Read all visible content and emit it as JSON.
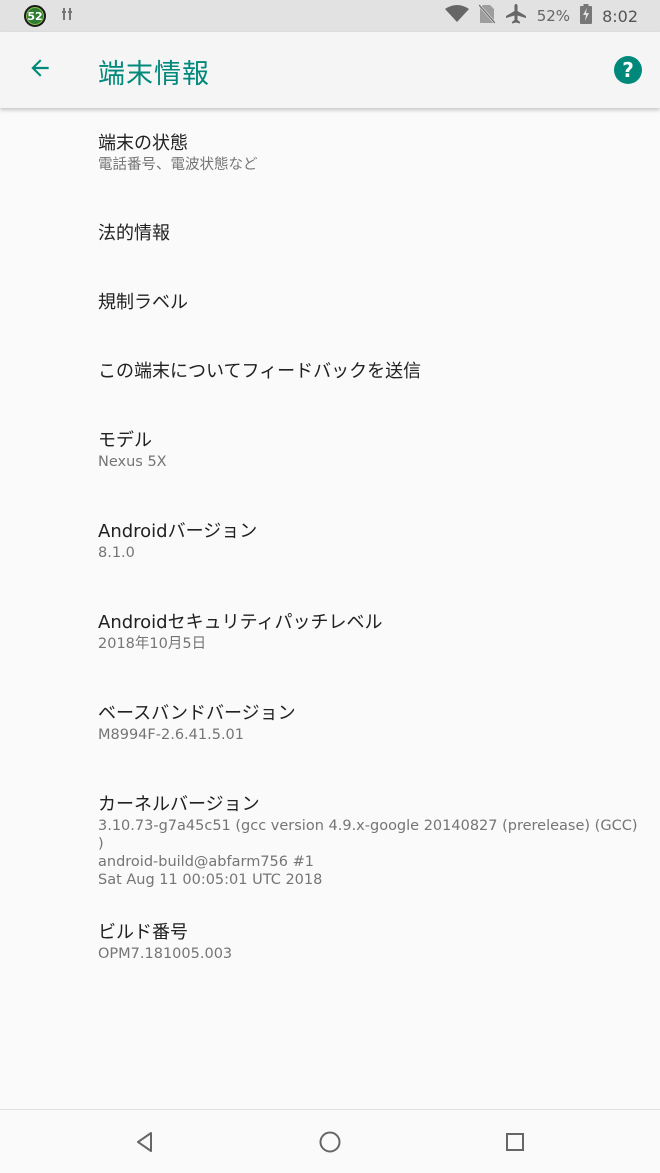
{
  "status_bar": {
    "notification_badge": "52",
    "battery_percent": "52%",
    "time": "8:02",
    "icons": [
      "wifi-icon",
      "no-sim-icon",
      "airplane-icon",
      "battery-charging-icon"
    ]
  },
  "app_bar": {
    "title": "端末情報",
    "accent_color": "#00897b"
  },
  "items": [
    {
      "title": "端末の状態",
      "subtitle": "電話番号、電波状態など"
    },
    {
      "title": "法的情報"
    },
    {
      "title": "規制ラベル"
    },
    {
      "title": "この端末についてフィードバックを送信"
    },
    {
      "title": "モデル",
      "subtitle": "Nexus 5X"
    },
    {
      "title": "Androidバージョン",
      "subtitle": "8.1.0"
    },
    {
      "title": "Androidセキュリティパッチレベル",
      "subtitle": "2018年10月5日"
    },
    {
      "title": "ベースバンドバージョン",
      "subtitle": "M8994F-2.6.41.5.01"
    },
    {
      "title": "カーネルバージョン",
      "subtitle": "3.10.73-g7a45c51 (gcc version 4.9.x-google 20140827 (prerelease) (GCC) )\nandroid-build@abfarm756 #1\nSat Aug 11 00:05:01 UTC 2018"
    },
    {
      "title": "ビルド番号",
      "subtitle": "OPM7.181005.003"
    }
  ],
  "nav_bar": {
    "icons": [
      "back-triangle-icon",
      "home-circle-icon",
      "recents-square-icon"
    ]
  }
}
